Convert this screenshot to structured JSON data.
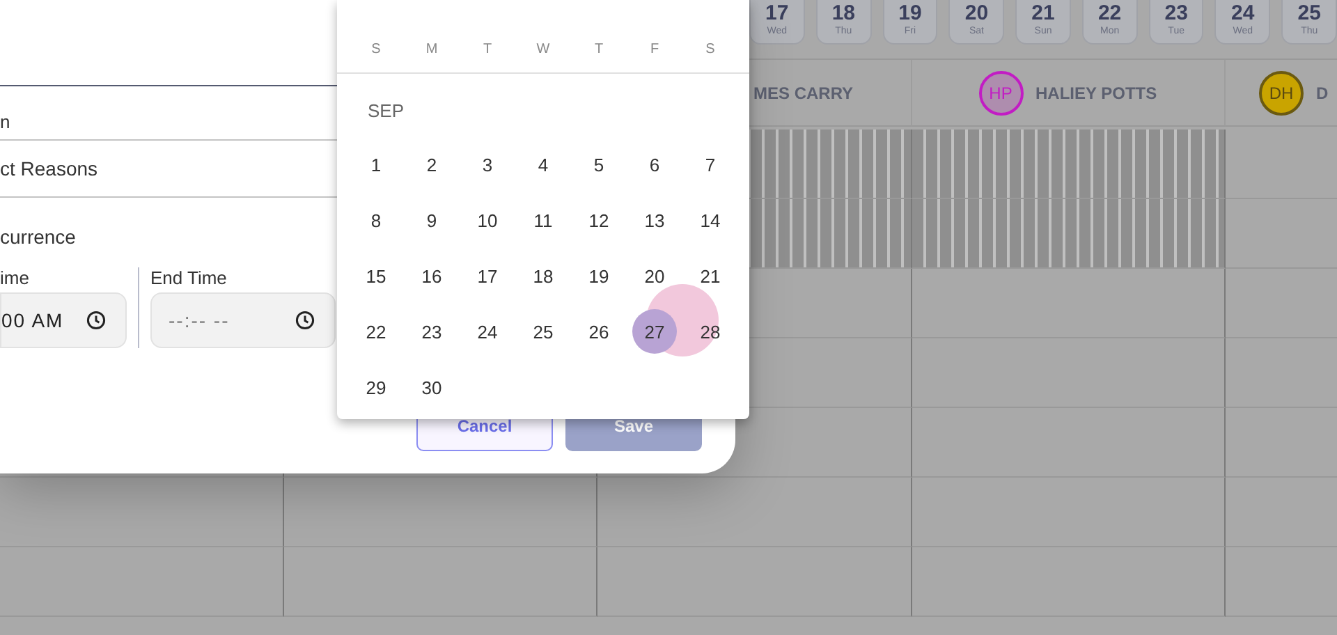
{
  "scheduler": {
    "date_chips": [
      {
        "day": "17",
        "weekday": "Wed"
      },
      {
        "day": "18",
        "weekday": "Thu"
      },
      {
        "day": "19",
        "weekday": "Fri"
      },
      {
        "day": "20",
        "weekday": "Sat"
      },
      {
        "day": "21",
        "weekday": "Sun"
      },
      {
        "day": "22",
        "weekday": "Mon"
      },
      {
        "day": "23",
        "weekday": "Tue"
      },
      {
        "day": "24",
        "weekday": "Wed"
      },
      {
        "day": "25",
        "weekday": "Thu"
      }
    ],
    "staff_columns": [
      {
        "name": "MES CARRY",
        "unavailable": true
      },
      {
        "initials": "HP",
        "name": "HALIEY POTTS",
        "color": "#c21cc4",
        "unavailable": true
      },
      {
        "initials": "DH",
        "name": "D",
        "color": "#c9a400",
        "unavailable": false
      }
    ]
  },
  "dialog": {
    "field_label": "n",
    "reason_select": {
      "value": "ct Reasons"
    },
    "recurrence_label": "currence",
    "start_time": {
      "label": "ime",
      "value": "00 AM"
    },
    "end_time": {
      "label": "End Time",
      "placeholder": "--:-- --"
    },
    "buttons": [
      {
        "label": "Cancel",
        "kind": "secondary",
        "disabled": false
      },
      {
        "label": "Save",
        "kind": "primary",
        "disabled": true
      }
    ]
  },
  "date_picker": {
    "weekdays": [
      "S",
      "M",
      "T",
      "W",
      "T",
      "F",
      "S"
    ],
    "month": "SEP",
    "days": [
      {
        "label": "1",
        "selected": false
      },
      {
        "label": "2",
        "selected": false
      },
      {
        "label": "3",
        "selected": false
      },
      {
        "label": "4",
        "selected": false
      },
      {
        "label": "5",
        "selected": false
      },
      {
        "label": "6",
        "selected": false
      },
      {
        "label": "7",
        "selected": false
      },
      {
        "label": "8",
        "selected": false
      },
      {
        "label": "9",
        "selected": false
      },
      {
        "label": "10",
        "selected": false
      },
      {
        "label": "11",
        "selected": false
      },
      {
        "label": "12",
        "selected": false
      },
      {
        "label": "13",
        "selected": false
      },
      {
        "label": "14",
        "selected": false
      },
      {
        "label": "15",
        "selected": false
      },
      {
        "label": "16",
        "selected": false
      },
      {
        "label": "17",
        "selected": false
      },
      {
        "label": "18",
        "selected": false
      },
      {
        "label": "19",
        "selected": false
      },
      {
        "label": "20",
        "selected": false
      },
      {
        "label": "21",
        "selected": false
      },
      {
        "label": "22",
        "selected": false
      },
      {
        "label": "23",
        "selected": false
      },
      {
        "label": "24",
        "selected": false
      },
      {
        "label": "25",
        "selected": false
      },
      {
        "label": "26",
        "selected": false
      },
      {
        "label": "27",
        "selected": true
      },
      {
        "label": "28",
        "selected": false
      },
      {
        "label": "29",
        "selected": false
      },
      {
        "label": "30",
        "selected": false
      }
    ]
  }
}
